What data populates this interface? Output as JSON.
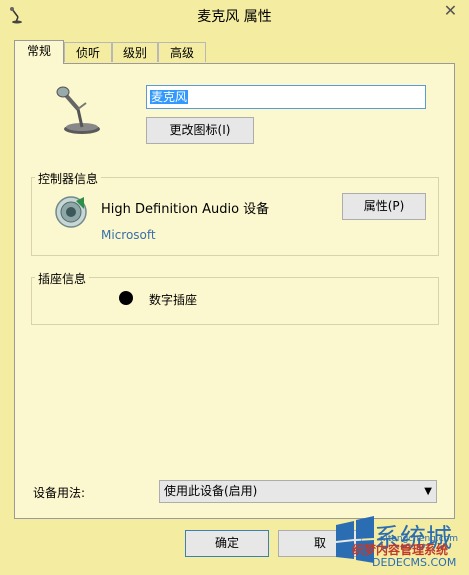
{
  "window": {
    "title": "麦克风 属性",
    "close_label": "✕"
  },
  "tabs": [
    {
      "label": "常规",
      "active": true
    },
    {
      "label": "侦听",
      "active": false
    },
    {
      "label": "级别",
      "active": false
    },
    {
      "label": "高级",
      "active": false
    }
  ],
  "general": {
    "device_name_value": "麦克风",
    "change_icon_button": "更改图标(I)"
  },
  "controller": {
    "group_label": "控制器信息",
    "device": "High Definition Audio 设备",
    "vendor": "Microsoft",
    "properties_button": "属性(P)"
  },
  "jack": {
    "group_label": "插座信息",
    "label": "数字插座"
  },
  "usage": {
    "label": "设备用法:",
    "selected": "使用此设备(启用)"
  },
  "dialog_buttons": {
    "ok": "确定",
    "cancel": "取"
  },
  "watermark": {
    "line1": "系统城",
    "line2": "织梦内容管理系统",
    "line3": "DEDECMS.COM",
    "line4": "xitongcheng.com"
  },
  "icons": {
    "close": "close-icon",
    "app": "microphone-icon",
    "device": "microphone-icon",
    "controller": "speaker-icon",
    "jack": "jack-dot-icon"
  }
}
